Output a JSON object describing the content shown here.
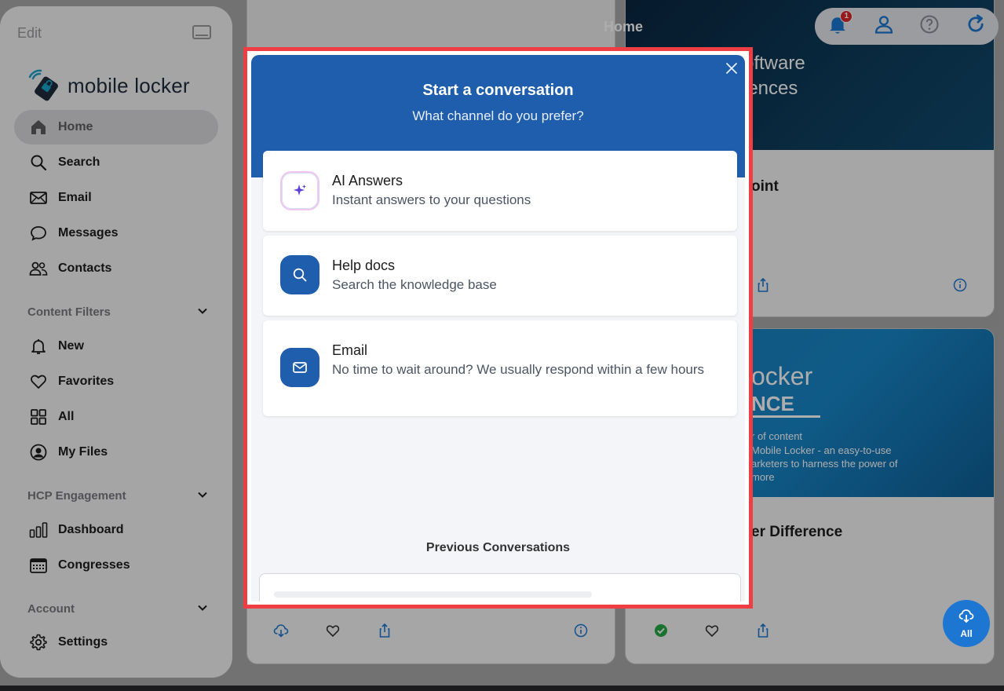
{
  "sidebar": {
    "edit_label": "Edit",
    "brand": "mobile locker",
    "nav": [
      {
        "label": "Home",
        "icon": "home-icon",
        "active": true
      },
      {
        "label": "Search",
        "icon": "search-icon"
      },
      {
        "label": "Email",
        "icon": "mail-icon"
      },
      {
        "label": "Messages",
        "icon": "chat-bubble-icon"
      },
      {
        "label": "Contacts",
        "icon": "contacts-icon"
      }
    ],
    "content_filters": {
      "title": "Content Filters",
      "items": [
        {
          "label": "New",
          "icon": "bell-icon"
        },
        {
          "label": "Favorites",
          "icon": "heart-icon"
        },
        {
          "label": "All",
          "icon": "grid-icon"
        },
        {
          "label": "My Files",
          "icon": "user-circle-icon"
        }
      ]
    },
    "hcp": {
      "title": "HCP Engagement",
      "items": [
        {
          "label": "Dashboard",
          "icon": "bar-chart-icon"
        },
        {
          "label": "Congresses",
          "icon": "calendar-icon"
        }
      ]
    },
    "account": {
      "title": "Account",
      "items": [
        {
          "label": "Settings",
          "icon": "gear-icon"
        }
      ]
    }
  },
  "header": {
    "title": "Home",
    "notification_count": "1"
  },
  "cards": {
    "right_top_thumb_line1": "oftware",
    "right_top_thumb_line2": "iences",
    "right_top_title": "oint",
    "right_bot_thumb_line1": "ocker",
    "right_bot_thumb_line2": "NCE",
    "right_bot_small1": "r of content",
    "right_bot_small2": "Mobile Locker - an easy-to-use",
    "right_bot_small3": "arketers to harness the power of",
    "right_bot_small4": "more",
    "right_bot_title": "er Difference"
  },
  "fab": {
    "label": "All"
  },
  "modal": {
    "title": "Start a conversation",
    "subtitle": "What channel do you prefer?",
    "options": [
      {
        "title": "AI Answers",
        "desc": "Instant answers to your questions",
        "icon": "sparkle-icon"
      },
      {
        "title": "Help docs",
        "desc": "Search the knowledge base",
        "icon": "search-icon"
      },
      {
        "title": "Email",
        "desc": "No time to wait around? We usually respond within a few hours",
        "icon": "mail-icon"
      }
    ],
    "previous_title": "Previous Conversations"
  },
  "colors": {
    "modal_header": "#1f5ead",
    "highlight_border": "#ee3d43",
    "fab": "#1d77d2",
    "badge": "#e0262a"
  }
}
